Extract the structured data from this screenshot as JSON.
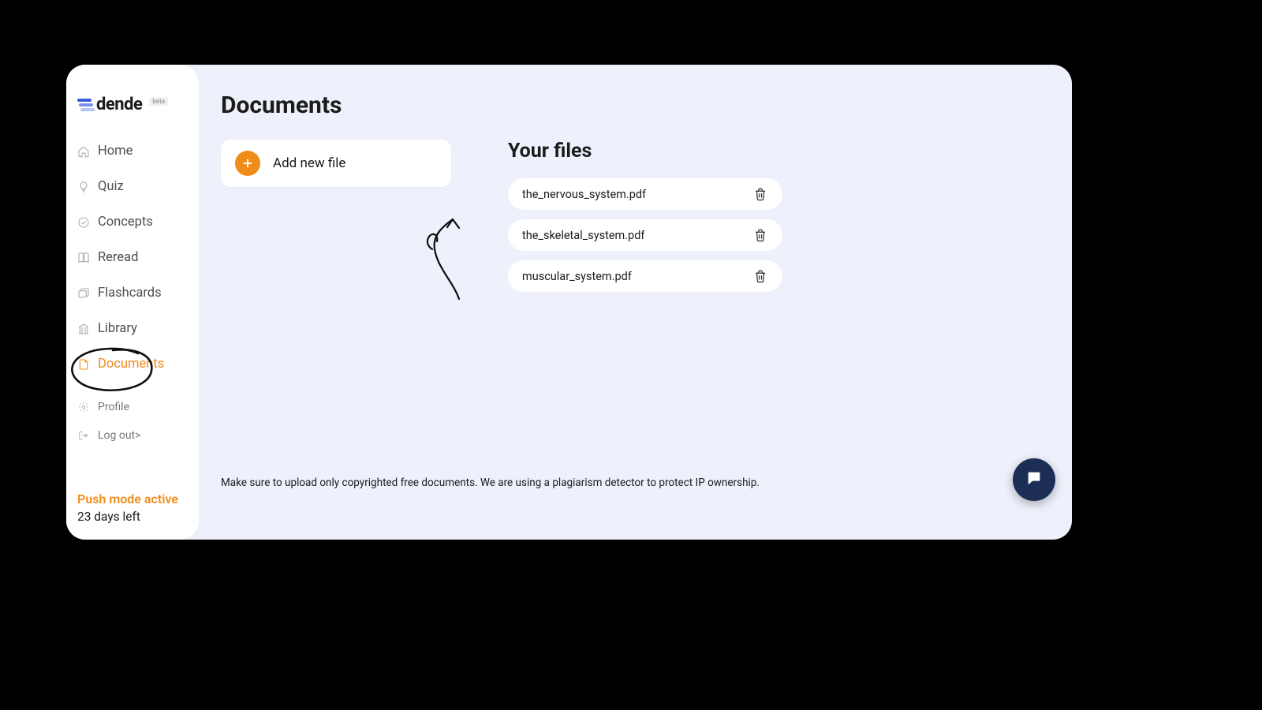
{
  "brand": {
    "name": "dende",
    "badge": "beta"
  },
  "sidebar": {
    "items": [
      {
        "label": "Home"
      },
      {
        "label": "Quiz"
      },
      {
        "label": "Concepts"
      },
      {
        "label": "Reread"
      },
      {
        "label": "Flashcards"
      },
      {
        "label": "Library"
      },
      {
        "label": "Documents"
      }
    ],
    "small_items": [
      {
        "label": "Profile"
      },
      {
        "label": "Log out>"
      }
    ],
    "push": {
      "title": "Push mode active",
      "days": "23 days left"
    }
  },
  "main": {
    "title": "Documents",
    "add_file_label": "Add new file",
    "files_heading": "Your files",
    "files": [
      {
        "name": "the_nervous_system.pdf"
      },
      {
        "name": "the_skeletal_system.pdf"
      },
      {
        "name": "muscular_system.pdf"
      }
    ],
    "footer_note": "Make sure to upload only copyrighted free documents. We are using a plagiarism detector to protect IP ownership."
  }
}
